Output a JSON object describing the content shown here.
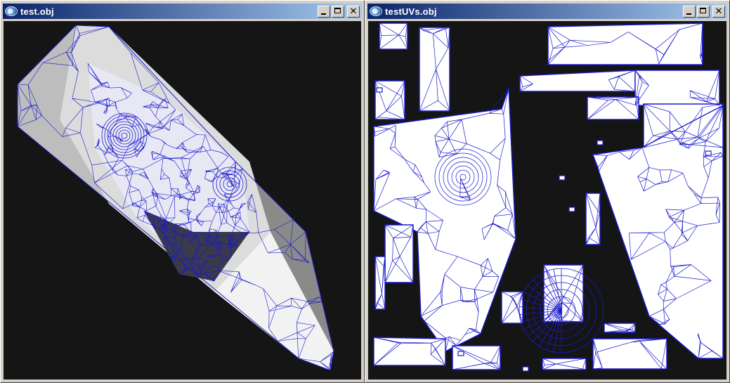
{
  "windows": [
    {
      "title": "test.obj",
      "icon": "app-icon",
      "buttons": {
        "minimize": "minimize-icon",
        "maximize": "maximize-icon",
        "close_label": "✕"
      }
    },
    {
      "title": "testUVs.obj",
      "icon": "app-icon",
      "buttons": {
        "minimize": "minimize-icon",
        "maximize": "maximize-icon",
        "close_label": "✕"
      }
    }
  ],
  "colors": {
    "viewport_background": "#151515",
    "wireframe": "#1a1acc",
    "surface_light": "#f2f2f2",
    "surface_mid": "#bdbdbd",
    "surface_dark": "#8a8a8a",
    "title_gradient_start": "#0a246a",
    "title_gradient_end": "#a6caf0"
  }
}
